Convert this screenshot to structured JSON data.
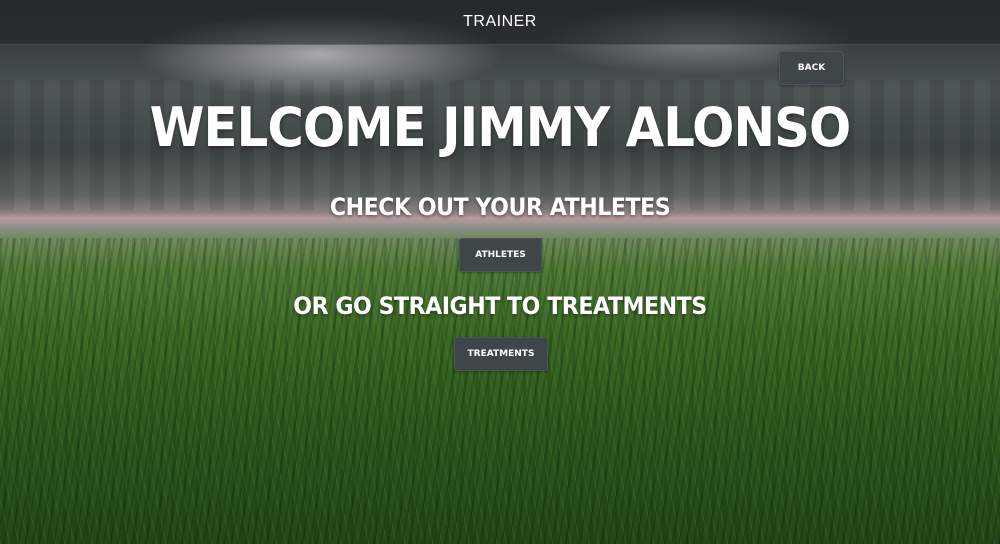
{
  "topbar": {
    "title": "TRAINER"
  },
  "buttons": {
    "back_label": "BACK",
    "athletes_label": "ATHLETES",
    "treatments_label": "TREATMENTS"
  },
  "main": {
    "welcome": "WELCOME JIMMY ALONSO",
    "athletes_prompt": "CHECK OUT YOUR ATHLETES",
    "treatments_prompt": "OR GO STRAIGHT TO TREATMENTS"
  },
  "colors": {
    "button_bg": "#3f4649",
    "text": "#ffffff",
    "topbar_bg": "#1e2224"
  }
}
